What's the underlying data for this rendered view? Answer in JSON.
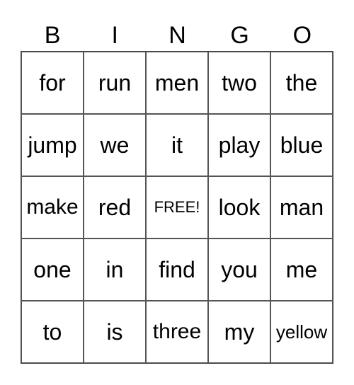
{
  "header": {
    "letters": [
      "B",
      "I",
      "N",
      "G",
      "O"
    ]
  },
  "grid": {
    "rows": [
      [
        "for",
        "run",
        "men",
        "two",
        "the"
      ],
      [
        "jump",
        "we",
        "it",
        "play",
        "blue"
      ],
      [
        "make",
        "red",
        "FREE!",
        "look",
        "man"
      ],
      [
        "one",
        "in",
        "find",
        "you",
        "me"
      ],
      [
        "to",
        "is",
        "three",
        "my",
        "yellow"
      ]
    ]
  },
  "colors": {
    "text": "#000000",
    "grid_line": "#555555",
    "background": "#ffffff"
  }
}
